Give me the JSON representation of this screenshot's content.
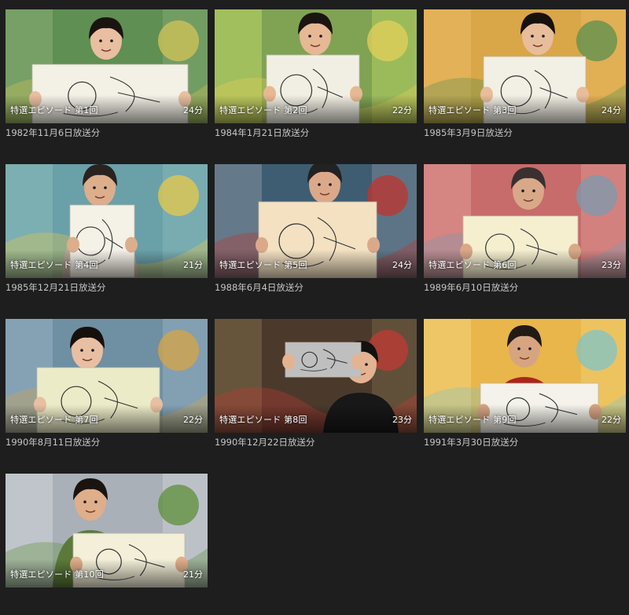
{
  "episodes": [
    {
      "label": "特選エピソード 第1回",
      "duration": "24分",
      "air_date": "1982年11月6日放送分",
      "colors": {
        "bg": "#5f8f52",
        "accent": "#d4c45a",
        "wall": "#7aa36a",
        "shirt": "#2b2b2b",
        "skin": "#e8bfa0",
        "hair": "#1a1410",
        "board": "#f3f0e6"
      }
    },
    {
      "label": "特選エピソード 第2回",
      "duration": "22分",
      "air_date": "1984年1月21日放送分",
      "colors": {
        "bg": "#7fa353",
        "accent": "#e4d05a",
        "wall": "#a7c45f",
        "shirt": "#8e2a2a",
        "skin": "#e6b894",
        "hair": "#1b1410",
        "board": "#f1efe3"
      }
    },
    {
      "label": "特選エピソード 第3回",
      "duration": "24分",
      "air_date": "1985年3月9日放送分",
      "colors": {
        "bg": "#d9a648",
        "accent": "#5a8f4d",
        "wall": "#e4b35a",
        "shirt": "#232323",
        "skin": "#e7bd9b",
        "hair": "#17110d",
        "board": "#f2efe4"
      }
    },
    {
      "label": "特選エピソード 第4回",
      "duration": "21分",
      "air_date": "1985年12月21日放送分",
      "colors": {
        "bg": "#6aa0a8",
        "accent": "#e8c94a",
        "wall": "#7fb1b3",
        "shirt": "#b8a59a",
        "skin": "#dcae8c",
        "hair": "#2a2220",
        "board": "#f4f1e7"
      }
    },
    {
      "label": "特選エピソード 第5回",
      "duration": "24分",
      "air_date": "1988年6月4日放送分",
      "colors": {
        "bg": "#3f5d72",
        "accent": "#c0342c",
        "wall": "#6b7f8e",
        "shirt": "#2a2f3a",
        "skin": "#dba98a",
        "hair": "#222",
        "board": "#f3e1c2"
      }
    },
    {
      "label": "特選エピソード 第6回",
      "duration": "23分",
      "air_date": "1989年6月10日放送分",
      "colors": {
        "bg": "#c76b6b",
        "accent": "#7a9bb0",
        "wall": "#d78a86",
        "shirt": "#4a3a3a",
        "skin": "#d9a888",
        "hair": "#3a3030",
        "board": "#f5efd0"
      }
    },
    {
      "label": "特選エピソード 第7回",
      "duration": "22分",
      "air_date": "1990年8月11日放送分",
      "colors": {
        "bg": "#6f8fa3",
        "accent": "#d8a444",
        "wall": "#8aa6b8",
        "shirt": "#2c2c2c",
        "skin": "#e8bfa2",
        "hair": "#16100c",
        "board": "#ecebc8"
      }
    },
    {
      "label": "特選エピソード 第8回",
      "duration": "23分",
      "air_date": "1990年12月22日放送分",
      "colors": {
        "bg": "#4b3a2c",
        "accent": "#c23a34",
        "wall": "#6b5a3e",
        "shirt": "#181818",
        "skin": "#e3b392",
        "hair": "#111",
        "board": "#bfbfbf"
      }
    },
    {
      "label": "特選エピソード 第9回",
      "duration": "22分",
      "air_date": "1991年3月30日放送分",
      "colors": {
        "bg": "#e8b64a",
        "accent": "#7fc4c8",
        "wall": "#f0c96a",
        "shirt": "#a8261e",
        "skin": "#d7a482",
        "hair": "#221a15",
        "board": "#f4f2ea"
      }
    },
    {
      "label": "特選エピソード 第10回",
      "duration": "21分",
      "air_date": "",
      "colors": {
        "bg": "#a9b0b8",
        "accent": "#5e8f3a",
        "wall": "#c4c9ce",
        "shirt": "#5b7a3a",
        "skin": "#dfae8a",
        "hair": "#1a1410",
        "board": "#f3efd8"
      }
    }
  ]
}
